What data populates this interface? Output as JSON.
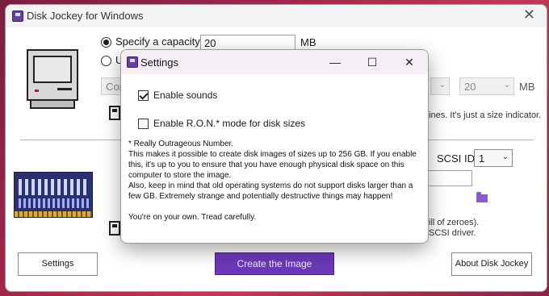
{
  "main": {
    "title": "Disk Jockey for Windows",
    "close_glyph": "✕",
    "specify_capacity_label": "Specify a capacity:",
    "capacity_value": "20",
    "capacity_unit": "MB",
    "use_label": "U",
    "disabled_select_text": "Con",
    "disabled_size_value": "20",
    "disabled_size_unit": "MB",
    "size_indicator_hint": "aines. It's just a size indicator.",
    "scsi_id_label": "SCSI ID:",
    "scsi_id_value": "1",
    "zeroes_hint": "ill of zeroes).",
    "driver_hint": "SCSI driver.",
    "settings_button": "Settings",
    "create_button": "Create the Image",
    "about_button": "About Disk Jockey"
  },
  "settings_dialog": {
    "title": "Settings",
    "minimize_glyph": "—",
    "maximize_glyph": "☐",
    "close_glyph": "✕",
    "enable_sounds_label": "Enable sounds",
    "enable_sounds_checked": true,
    "enable_ron_label": "Enable R.O.N.* mode for disk sizes",
    "enable_ron_checked": false,
    "footnote_lines": [
      "* Really Outrageous Number.",
      "This makes it possible to create disk images of sizes up to 256 GB. If you enable",
      "this, it's up to you to ensure that you have enough physical disk space on this",
      "computer to store the image.",
      "Also, keep in mind that old operating systems do not support disks larger than a",
      "few GB. Extremely strange and potentially destructive things may happen!"
    ],
    "closing_line": "You're on your own. Tread carefully."
  },
  "colors": {
    "accent": "#6b39b5",
    "desktop": "#a0274a"
  },
  "icons": {
    "app": "disk-jockey-app-icon",
    "folder": "folder-icon",
    "mac": "classic-mac-icon",
    "scsi": "scsi-card-icon"
  }
}
